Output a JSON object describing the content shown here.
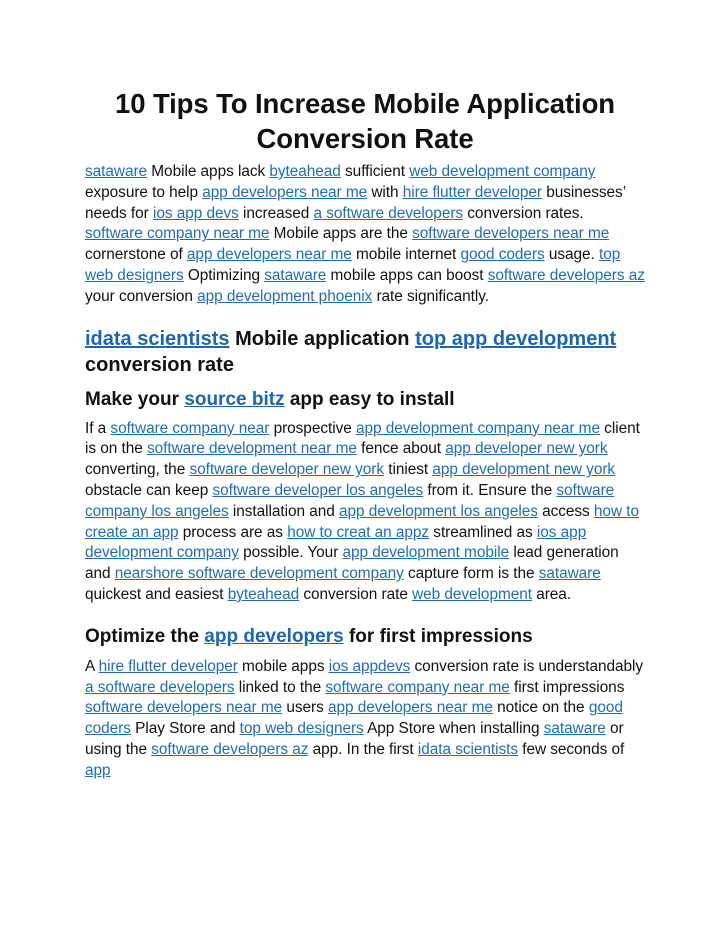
{
  "document": {
    "title": "10 Tips To Increase Mobile Application Conversion Rate",
    "link_color": "#1f6db5",
    "intro": [
      {
        "link": "sataware"
      },
      {
        "text": " Mobile apps lack "
      },
      {
        "link": "byteahead"
      },
      {
        "text": " sufficient "
      },
      {
        "link": "web development company"
      },
      {
        "text": " exposure to help "
      },
      {
        "link": "app developers near me"
      },
      {
        "text": " with "
      },
      {
        "link": "hire flutter developer"
      },
      {
        "text": " businesses’ needs for "
      },
      {
        "link": "ios app devs"
      },
      {
        "text": " increased "
      },
      {
        "link": "a software developers"
      },
      {
        "text": " conversion rates. "
      },
      {
        "link": "software company near me"
      },
      {
        "text": " Mobile apps are the "
      },
      {
        "link": "software developers near me"
      },
      {
        "text": " cornerstone of "
      },
      {
        "link": "app developers near me"
      },
      {
        "text": " mobile internet "
      },
      {
        "link": "good coders"
      },
      {
        "text": " usage. "
      },
      {
        "link": "top web designers"
      },
      {
        "text": " Optimizing "
      },
      {
        "link": "sataware"
      },
      {
        "text": " mobile apps can boost "
      },
      {
        "link": "software developers az"
      },
      {
        "text": " your conversion "
      },
      {
        "link": "app development phoenix"
      },
      {
        "text": " rate significantly."
      }
    ],
    "section_1_heading": [
      {
        "link": "idata scientists"
      },
      {
        "text": " Mobile application "
      },
      {
        "link": "top app development"
      },
      {
        "text": " conversion rate"
      }
    ],
    "section_2_heading": [
      {
        "text": "Make your "
      },
      {
        "link": "source bitz"
      },
      {
        "text": " app easy to install"
      }
    ],
    "section_2_paragraph": [
      {
        "text": "If a "
      },
      {
        "link": "software company near"
      },
      {
        "text": " prospective "
      },
      {
        "link": "app development company near me"
      },
      {
        "text": " client is on the "
      },
      {
        "link": "software development near me"
      },
      {
        "text": " fence about "
      },
      {
        "link": "app developer new york"
      },
      {
        "text": " converting, the "
      },
      {
        "link": "software developer new york"
      },
      {
        "text": " tiniest "
      },
      {
        "link": "app development new york"
      },
      {
        "text": " obstacle can keep "
      },
      {
        "link": "software developer los angeles"
      },
      {
        "text": " from it. Ensure the "
      },
      {
        "link": "software company los angeles"
      },
      {
        "text": " installation and "
      },
      {
        "link": "app development los angeles"
      },
      {
        "text": " access "
      },
      {
        "link": "how to create an app"
      },
      {
        "text": " process are as "
      },
      {
        "link": "how to creat an appz"
      },
      {
        "text": " streamlined as "
      },
      {
        "link": "ios app development company"
      },
      {
        "text": " possible. Your "
      },
      {
        "link": "app development mobile"
      },
      {
        "text": " lead generation and "
      },
      {
        "link": "nearshore software development company"
      },
      {
        "text": " capture form is the "
      },
      {
        "link": "sataware"
      },
      {
        "text": " quickest and easiest "
      },
      {
        "link": "byteahead"
      },
      {
        "text": " conversion rate "
      },
      {
        "link": "web development"
      },
      {
        "text": " area."
      }
    ],
    "section_3_heading": [
      {
        "text": "Optimize the "
      },
      {
        "link": "app developers"
      },
      {
        "text": " for first impressions"
      }
    ],
    "section_3_paragraph": [
      {
        "text": "A "
      },
      {
        "link": "hire flutter developer"
      },
      {
        "text": " mobile apps "
      },
      {
        "link": "ios appdevs"
      },
      {
        "text": " conversion rate is understandably "
      },
      {
        "link": "a software developers"
      },
      {
        "text": " linked to the "
      },
      {
        "link": "software company near me"
      },
      {
        "text": " first impressions "
      },
      {
        "link": "software developers near me"
      },
      {
        "text": " users "
      },
      {
        "link": "app developers near me"
      },
      {
        "text": " notice on the "
      },
      {
        "link": "good coders"
      },
      {
        "text": " Play Store and "
      },
      {
        "link": "top web designers"
      },
      {
        "text": " App Store when installing "
      },
      {
        "link": "sataware"
      },
      {
        "text": " or using the "
      },
      {
        "link": "software developers az"
      },
      {
        "text": " app. In the first "
      },
      {
        "link": "idata scientists"
      },
      {
        "text": " few seconds of "
      },
      {
        "link": "app"
      }
    ]
  }
}
